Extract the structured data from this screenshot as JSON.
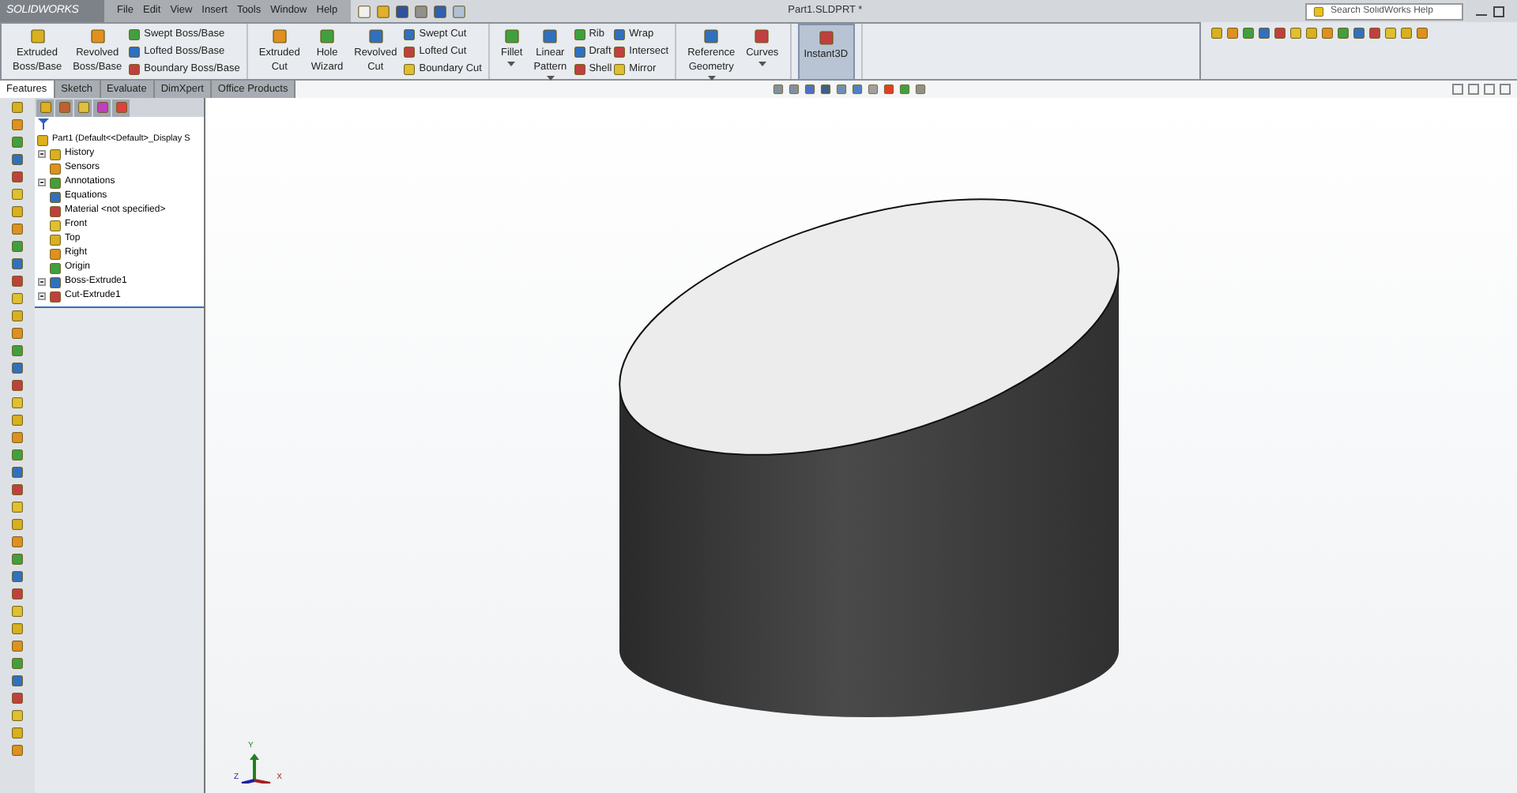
{
  "app": {
    "logo": "SOLIDWORKS",
    "menu": [
      "File",
      "Edit",
      "View",
      "Insert",
      "Tools",
      "Window",
      "Help"
    ],
    "title": "Part1.SLDPRT *",
    "search": {
      "placeholder": "Search SolidWorks Help"
    }
  },
  "ribbon": {
    "groups": [
      {
        "items": [
          {
            "kind": "large",
            "lines": [
              "Extruded",
              "Boss/Base"
            ]
          },
          {
            "kind": "large",
            "lines": [
              "Revolved",
              "Boss/Base"
            ]
          },
          {
            "kind": "stack",
            "rows": [
              "Swept Boss/Base",
              "Lofted Boss/Base",
              "Boundary Boss/Base"
            ]
          }
        ]
      },
      {
        "items": [
          {
            "kind": "large",
            "lines": [
              "Extruded",
              "Cut"
            ]
          },
          {
            "kind": "large",
            "lines": [
              "Hole",
              "Wizard"
            ]
          },
          {
            "kind": "large",
            "lines": [
              "Revolved",
              "Cut"
            ]
          },
          {
            "kind": "stack",
            "rows": [
              "Swept Cut",
              "Lofted Cut",
              "Boundary Cut"
            ]
          }
        ]
      },
      {
        "items": [
          {
            "kind": "large",
            "lines": [
              "Fillet"
            ],
            "dropdown": true
          },
          {
            "kind": "large",
            "lines": [
              "Linear",
              "Pattern"
            ],
            "dropdown": true
          },
          {
            "kind": "stack",
            "rows": [
              "Rib",
              "Draft",
              "Shell"
            ]
          },
          {
            "kind": "stack",
            "rows": [
              "Wrap",
              "Intersect",
              "Mirror"
            ]
          }
        ]
      },
      {
        "items": [
          {
            "kind": "large",
            "lines": [
              "Reference",
              "Geometry"
            ],
            "dropdown": true
          },
          {
            "kind": "large",
            "lines": [
              "Curves"
            ],
            "dropdown": true
          }
        ]
      },
      {
        "items": [
          {
            "kind": "large",
            "lines": [
              "Instant3D"
            ],
            "selected": true
          }
        ]
      }
    ]
  },
  "tabs": [
    {
      "label": "Features",
      "selected": true
    },
    {
      "label": "Sketch",
      "selected": false
    },
    {
      "label": "Evaluate",
      "selected": false
    },
    {
      "label": "DimXpert",
      "selected": false
    },
    {
      "label": "Office Products",
      "selected": false
    }
  ],
  "tree": {
    "label": "Part1  (Default<<Default>_Display S",
    "children": [
      {
        "label": "History",
        "toggle": true
      },
      {
        "label": "Sensors",
        "toggle": false
      },
      {
        "label": "Annotations",
        "toggle": true
      },
      {
        "label": "Equations",
        "toggle": false
      },
      {
        "label": "Material <not specified>",
        "toggle": false
      },
      {
        "label": "Front",
        "toggle": false
      },
      {
        "label": "Top",
        "toggle": false
      },
      {
        "label": "Right",
        "toggle": false
      },
      {
        "label": "Origin",
        "toggle": false
      },
      {
        "label": "Boss-Extrude1",
        "toggle": true
      },
      {
        "label": "Cut-Extrude1",
        "toggle": true
      }
    ]
  },
  "triad": {
    "axes": [
      "Y",
      "X",
      "Z"
    ]
  }
}
